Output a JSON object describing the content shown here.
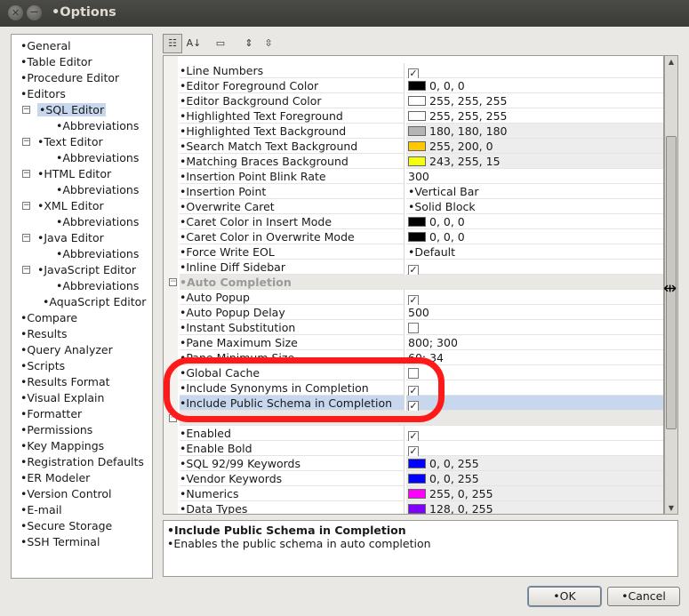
{
  "window": {
    "title": "•Options"
  },
  "tree": [
    {
      "label": "•General",
      "indent": 0
    },
    {
      "label": "•Table Editor",
      "indent": 0
    },
    {
      "label": "•Procedure Editor",
      "indent": 0
    },
    {
      "label": "•Editors",
      "indent": 0
    },
    {
      "label": "•SQL Editor",
      "indent": 1,
      "toggle": true,
      "selected": true
    },
    {
      "label": "•Abbreviations",
      "indent": 2
    },
    {
      "label": "•Text Editor",
      "indent": 1,
      "toggle": true
    },
    {
      "label": "•Abbreviations",
      "indent": 2
    },
    {
      "label": "•HTML Editor",
      "indent": 1,
      "toggle": true
    },
    {
      "label": "•Abbreviations",
      "indent": 2
    },
    {
      "label": "•XML Editor",
      "indent": 1,
      "toggle": true
    },
    {
      "label": "•Abbreviations",
      "indent": 2
    },
    {
      "label": "•Java Editor",
      "indent": 1,
      "toggle": true
    },
    {
      "label": "•Abbreviations",
      "indent": 2
    },
    {
      "label": "•JavaScript Editor",
      "indent": 1,
      "toggle": true
    },
    {
      "label": "•Abbreviations",
      "indent": 2
    },
    {
      "label": "•AquaScript Editor",
      "indent": 3
    },
    {
      "label": "•Compare",
      "indent": 0
    },
    {
      "label": "•Results",
      "indent": 0
    },
    {
      "label": "•Query Analyzer",
      "indent": 0
    },
    {
      "label": "•Scripts",
      "indent": 0
    },
    {
      "label": "•Results Format",
      "indent": 0
    },
    {
      "label": "•Visual Explain",
      "indent": 0
    },
    {
      "label": "•Formatter",
      "indent": 0
    },
    {
      "label": "•Permissions",
      "indent": 0
    },
    {
      "label": "•Key Mappings",
      "indent": 0
    },
    {
      "label": "•Registration Defaults",
      "indent": 0
    },
    {
      "label": "•ER Modeler",
      "indent": 0
    },
    {
      "label": "•Version Control",
      "indent": 0
    },
    {
      "label": "•E-mail",
      "indent": 0
    },
    {
      "label": "•Secure Storage",
      "indent": 0
    },
    {
      "label": "•SSH Terminal",
      "indent": 0
    }
  ],
  "toolbar": {
    "categorized_icon": "categorized-icon",
    "alphabetical_icon": "sort-alpha-icon",
    "description_icon": "description-icon",
    "expand_icon": "expand-all-icon",
    "collapse_icon": "collapse-all-icon"
  },
  "properties": [
    {
      "key": "•Line Numbers",
      "type": "check",
      "checked": true
    },
    {
      "key": "•Editor Foreground Color",
      "type": "color",
      "color": "#000000",
      "value": "0, 0, 0"
    },
    {
      "key": "•Editor Background Color",
      "type": "color",
      "color": "#ffffff",
      "value": "255, 255, 255"
    },
    {
      "key": "•Highlighted Text Foreground",
      "type": "color",
      "color": "#ffffff",
      "value": "255, 255, 255"
    },
    {
      "key": "•Highlighted Text Background",
      "type": "color",
      "color": "#b4b4b4",
      "value": "180, 180, 180"
    },
    {
      "key": "•Search Match Text Background",
      "type": "color",
      "color": "#ffc800",
      "value": "255, 200, 0"
    },
    {
      "key": "•Matching Braces Background",
      "type": "color",
      "color": "#f3ff0f",
      "value": "243, 255, 15"
    },
    {
      "key": "•Insertion Point Blink Rate",
      "type": "text",
      "value": "300"
    },
    {
      "key": "•Insertion Point",
      "type": "text",
      "value": "•Vertical Bar"
    },
    {
      "key": "•Overwrite Caret",
      "type": "text",
      "value": "•Solid Block"
    },
    {
      "key": "•Caret Color in Insert Mode",
      "type": "color",
      "color": "#000000",
      "value": "0, 0, 0"
    },
    {
      "key": "•Caret Color in Overwrite Mode",
      "type": "color",
      "color": "#000000",
      "value": "0, 0, 0"
    },
    {
      "key": "•Force Write EOL",
      "type": "text",
      "value": "•Default"
    },
    {
      "key": "•Inline Diff Sidebar",
      "type": "check",
      "checked": true
    },
    {
      "key": "•Auto Completion",
      "type": "category"
    },
    {
      "key": "•Auto Popup",
      "type": "check",
      "checked": true
    },
    {
      "key": "•Auto Popup Delay",
      "type": "text",
      "value": "500"
    },
    {
      "key": "•Instant Substitution",
      "type": "check",
      "checked": false
    },
    {
      "key": "•Pane Maximum Size",
      "type": "text",
      "value": "800; 300"
    },
    {
      "key": "•Pane Minimum Size",
      "type": "text",
      "value": "60; 34"
    },
    {
      "key": "•Global Cache",
      "type": "check",
      "checked": false
    },
    {
      "key": "•Include Synonyms in Completion",
      "type": "check",
      "checked": true
    },
    {
      "key": "•Include Public Schema in Completion",
      "type": "check",
      "checked": true,
      "selected": true
    },
    {
      "key": "",
      "type": "category"
    },
    {
      "key": "•Enabled",
      "type": "check",
      "checked": true
    },
    {
      "key": "•Enable Bold",
      "type": "check",
      "checked": true
    },
    {
      "key": "•SQL 92/99 Keywords",
      "type": "color",
      "color": "#0000ff",
      "value": "0, 0, 255"
    },
    {
      "key": "•Vendor Keywords",
      "type": "color",
      "color": "#0000ff",
      "value": "0, 0, 255"
    },
    {
      "key": "•Numerics",
      "type": "color",
      "color": "#ff00ff",
      "value": "255, 0, 255"
    },
    {
      "key": "•Data Types",
      "type": "color",
      "color": "#8000ff",
      "value": "128, 0, 255"
    }
  ],
  "description": {
    "title": "•Include Public Schema in Completion",
    "text": "•Enables the public schema in auto completion"
  },
  "buttons": {
    "ok": "•OK",
    "cancel": "•Cancel"
  }
}
